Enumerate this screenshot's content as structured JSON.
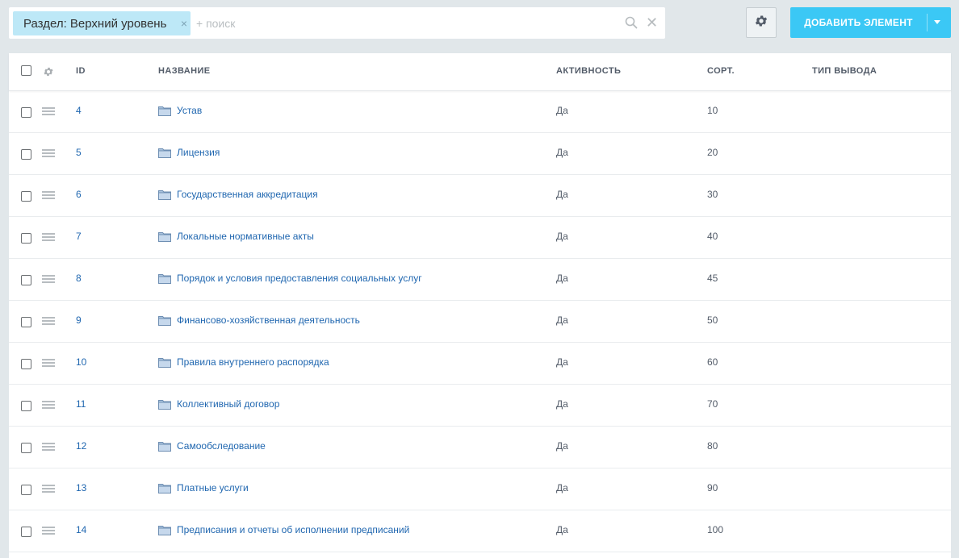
{
  "filter": {
    "chip_label": "Раздел: Верхний уровень",
    "chip_remove": "×",
    "search_placeholder": "+ поиск",
    "clear_glyph": "✕"
  },
  "toolbar": {
    "settings_icon": "gear-icon",
    "add_label": "ДОБАВИТЬ ЭЛЕМЕНТ"
  },
  "colors": {
    "accent": "#3bc8f5",
    "chip_bg": "#bde8f7",
    "link": "#2067b0",
    "page_bg": "#e1e7ea"
  },
  "grid": {
    "columns": [
      "ID",
      "НАЗВАНИЕ",
      "АКТИВНОСТЬ",
      "СОРТ.",
      "ТИП ВЫВОДА"
    ],
    "rows": [
      {
        "id": "4",
        "name": "Устав",
        "active": "Да",
        "sort": "10"
      },
      {
        "id": "5",
        "name": "Лицензия",
        "active": "Да",
        "sort": "20"
      },
      {
        "id": "6",
        "name": "Государственная аккредитация",
        "active": "Да",
        "sort": "30"
      },
      {
        "id": "7",
        "name": "Локальные нормативные акты",
        "active": "Да",
        "sort": "40"
      },
      {
        "id": "8",
        "name": "Порядок и условия предоставления социальных услуг",
        "active": "Да",
        "sort": "45"
      },
      {
        "id": "9",
        "name": "Финансово-хозяйственная деятельность",
        "active": "Да",
        "sort": "50"
      },
      {
        "id": "10",
        "name": "Правила внутреннего распорядка",
        "active": "Да",
        "sort": "60"
      },
      {
        "id": "11",
        "name": "Коллективный договор",
        "active": "Да",
        "sort": "70"
      },
      {
        "id": "12",
        "name": "Самообследование",
        "active": "Да",
        "sort": "80"
      },
      {
        "id": "13",
        "name": "Платные услуги",
        "active": "Да",
        "sort": "90"
      },
      {
        "id": "14",
        "name": "Предписания и отчеты об исполнении предписаний",
        "active": "Да",
        "sort": "100"
      }
    ]
  }
}
